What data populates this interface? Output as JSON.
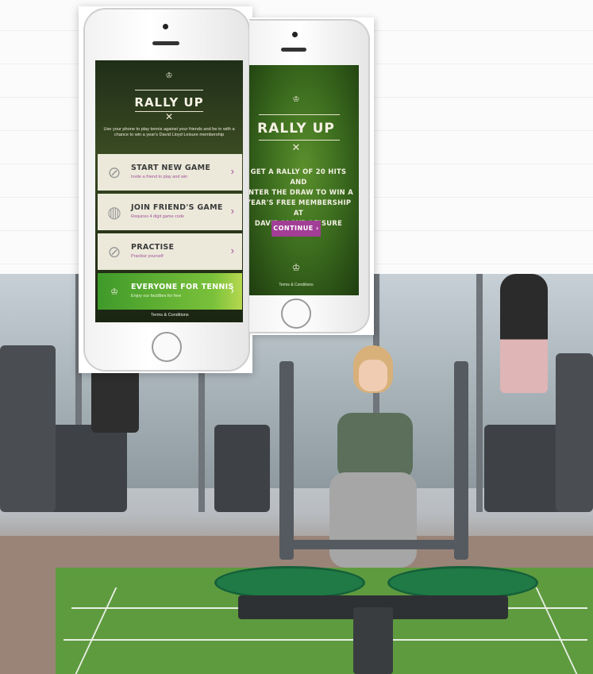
{
  "phone_left": {
    "brand": "David Lloyd",
    "title": "RALLY UP",
    "description": "Use your phone to play tennis against your friends and be in with a chance to win a year's David Lloyd Leisure membership",
    "menu": [
      {
        "title": "START NEW GAME",
        "subtitle": "Invite a friend to play and win",
        "icon": "tennis-racket-icon"
      },
      {
        "title": "JOIN FRIEND'S GAME",
        "subtitle": "Requires 4 digit game code",
        "icon": "tennis-ball-icon"
      },
      {
        "title": "PRACTISE",
        "subtitle": "Practise yourself",
        "icon": "tennis-racket-icon"
      },
      {
        "title": "EVERYONE FOR TENNIS",
        "subtitle": "Enjoy our facilities for free",
        "icon": "david-lloyd-logo"
      }
    ],
    "footer": "Terms & Conditions"
  },
  "phone_right": {
    "brand": "David Lloyd",
    "title": "RALLY UP",
    "description_lines": [
      "GET A RALLY OF 20 HITS AND",
      "ENTER THE DRAW TO WIN A",
      "YEAR'S FREE MEMBERSHIP AT",
      "DAVID LLOYD LEISURE"
    ],
    "continue_label": "CONTINUE",
    "footer": "Terms & Conditions"
  },
  "colors": {
    "accent": "#a23e96",
    "menu_bg": "#ece9db",
    "green_item": "#5fae30",
    "turf": "#5e9b3f",
    "plate": "#1f7a45"
  }
}
